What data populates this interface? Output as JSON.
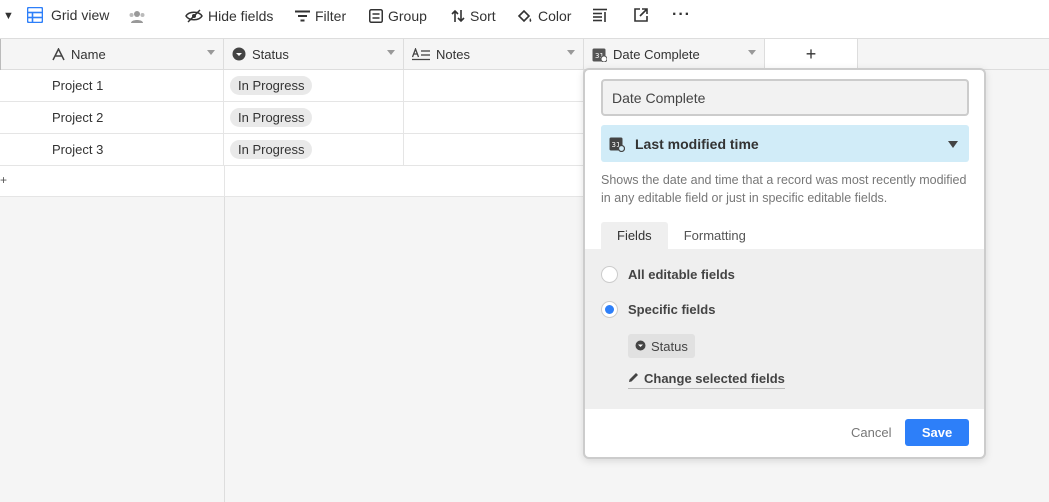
{
  "toolbar": {
    "view_name": "Grid view",
    "hide_fields": "Hide fields",
    "filter": "Filter",
    "group": "Group",
    "sort": "Sort",
    "color": "Color"
  },
  "columns": {
    "name": "Name",
    "status": "Status",
    "notes": "Notes",
    "date_complete": "Date Complete",
    "add": "+"
  },
  "rows": [
    {
      "name": "Project 1",
      "status": "In Progress",
      "notes": ""
    },
    {
      "name": "Project 2",
      "status": "In Progress",
      "notes": ""
    },
    {
      "name": "Project 3",
      "status": "In Progress",
      "notes": ""
    }
  ],
  "add_row": "+",
  "popup": {
    "field_name_value": "Date Complete",
    "field_type": "Last modified time",
    "description": "Shows the date and time that a record was most recently modified in any editable field or just in specific editable fields.",
    "tabs": [
      "Fields",
      "Formatting"
    ],
    "active_tab": "Fields",
    "options": {
      "all": "All editable fields",
      "specific": "Specific fields",
      "selected": "specific"
    },
    "selected_field": "Status",
    "change_fields": "Change selected fields",
    "cancel": "Cancel",
    "save": "Save"
  },
  "colors": {
    "accent": "#2d7ff9",
    "type_select_bg": "#d1ecf8"
  },
  "icons": {
    "view": "grid-icon",
    "people": "people-icon",
    "hide": "eye-slash-icon",
    "filter": "filter-icon",
    "group": "group-icon",
    "sort": "sort-icon",
    "color": "paint-bucket-icon",
    "row_height": "row-height-icon",
    "share": "share-icon",
    "more": "ellipsis-icon"
  }
}
